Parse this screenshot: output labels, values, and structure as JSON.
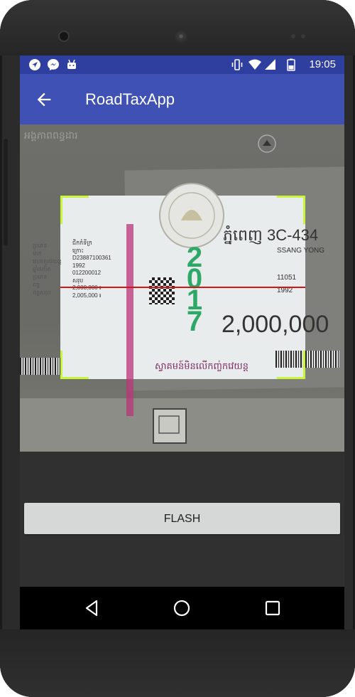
{
  "status_bar": {
    "time": "19:05",
    "left_icons": [
      "navigation-icon",
      "messenger-icon",
      "android-icon"
    ],
    "right_icons": [
      "vibrate-icon",
      "wifi-icon",
      "signal-icon",
      "battery-icon"
    ]
  },
  "app_bar": {
    "title": "RoadTaxApp",
    "back_icon": "arrow-left-icon"
  },
  "camera_preview": {
    "sticker": {
      "year": "2017",
      "plate": "ភ្នំពេញ 3C-434",
      "brand": "SSANG YONG",
      "code": "11051",
      "year_made": "1992",
      "amount": "2,000,000",
      "left_labels": [
        "ប្រភេទ",
        "ម៉ាក",
        "លេខតួរថយន្ត",
        "ឆ្នាំផលិត",
        "ប្រភេទ",
        "ពន្ធ",
        "ពន្ធសរុប"
      ],
      "left_values": [
        "ជីកកំទីក្រ",
        "ក្រោះ",
        "D23887100361",
        "1992",
        "012200012",
        "សរុប",
        "2,000,000 ៛",
        "2,005,000 ៛"
      ],
      "bottom_text": "ស្វាគមន៍មិនលើកញ្ច់កវេយន្ត",
      "top_text": "អង្គភាពពន្ធដារ"
    },
    "scan_line_color": "#d41515",
    "corner_color": "#c9f53a"
  },
  "flash_button": {
    "label": "FLASH"
  },
  "nav_bar": {
    "back_icon": "triangle-back-icon",
    "home_icon": "circle-home-icon",
    "recents_icon": "square-recents-icon"
  },
  "colors": {
    "app_bar": "#3f51b5",
    "status_bar": "#2e3fa0",
    "button_bg": "#d6d7d7"
  }
}
